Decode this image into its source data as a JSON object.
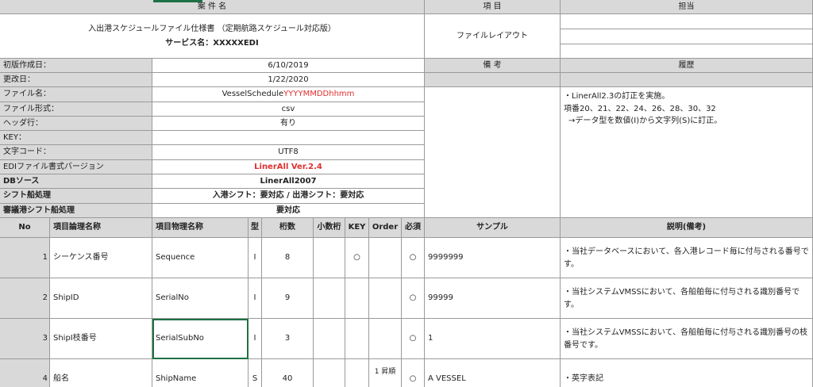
{
  "header": {
    "case_label": "案 件 名",
    "item_label": "項 目",
    "owner_label": "担当",
    "doc_title": "入出港スケジュールファイル仕様書 （定期航路スケジュール対応版）",
    "service_name": "サービス名：XXXXXEDI",
    "file_layout": "ファイルレイアウト",
    "remarks_label": "備 考",
    "history_label": "履歴"
  },
  "meta": [
    {
      "label": "初版作成日：",
      "value": "6/10/2019"
    },
    {
      "label": "更改日：",
      "value": "1/22/2020"
    },
    {
      "label": "ファイル名：",
      "value_prefix": "VesselSchedule",
      "value_suffix": "YYYYMMDDhhmm"
    },
    {
      "label": "ファイル形式：",
      "value": "csv"
    },
    {
      "label": "ヘッダ行：",
      "value": "有り"
    },
    {
      "label": "KEY：",
      "value": ""
    },
    {
      "label": "文字コード：",
      "value": "UTF8"
    },
    {
      "label": "EDIファイル書式バージョン",
      "value": "LinerAll Ver.2.4"
    },
    {
      "label": "DBソース",
      "value": "LinerAll2007"
    },
    {
      "label": "シフト船処理",
      "value": "入港シフト：要対応 / 出港シフト：要対応"
    },
    {
      "label": "審議港シフト船処理",
      "value": "要対応"
    }
  ],
  "history": {
    "line1": "・LinerAll2.3の訂正を実施。",
    "line2": "項番20、21、22、24、26、28、30、32",
    "line3": "→データ型を数値(I)から文字列(S)に訂正。"
  },
  "columns": {
    "no": "No",
    "logical": "項目論理名称",
    "physical": "項目物理名称",
    "type": "型",
    "digits": "桁数",
    "decimal": "小数桁",
    "key": "KEY",
    "order": "Order",
    "required": "必須",
    "sample": "サンプル",
    "desc": "説明(備考)"
  },
  "rows": [
    {
      "no": "1",
      "logical": "シーケンス番号",
      "physical": "Sequence",
      "type": "I",
      "digits": "8",
      "key": "○",
      "order": "",
      "required": "○",
      "sample": "9999999",
      "desc": "・当社データベースにおいて、各入港レコード毎に付与される番号です。"
    },
    {
      "no": "2",
      "logical": "ShipID",
      "physical": "SerialNo",
      "type": "I",
      "digits": "9",
      "key": "",
      "order": "",
      "required": "○",
      "sample": "99999",
      "desc": "・当社システムVMSSにおいて、各船舶毎に付与される識別番号です。"
    },
    {
      "no": "3",
      "logical": "ShipI枝番号",
      "physical": "SerialSubNo",
      "type": "I",
      "digits": "3",
      "key": "",
      "order": "",
      "required": "○",
      "sample": "1",
      "desc": "・当社システムVMSSにおいて、各船舶毎に付与される識別番号の枝番号です。"
    },
    {
      "no": "4",
      "logical": "船名",
      "physical": "ShipName",
      "type": "S",
      "digits": "40",
      "key": "",
      "order": "1 昇順",
      "required": "○",
      "sample": "A VESSEL",
      "desc": "・英字表記"
    }
  ]
}
